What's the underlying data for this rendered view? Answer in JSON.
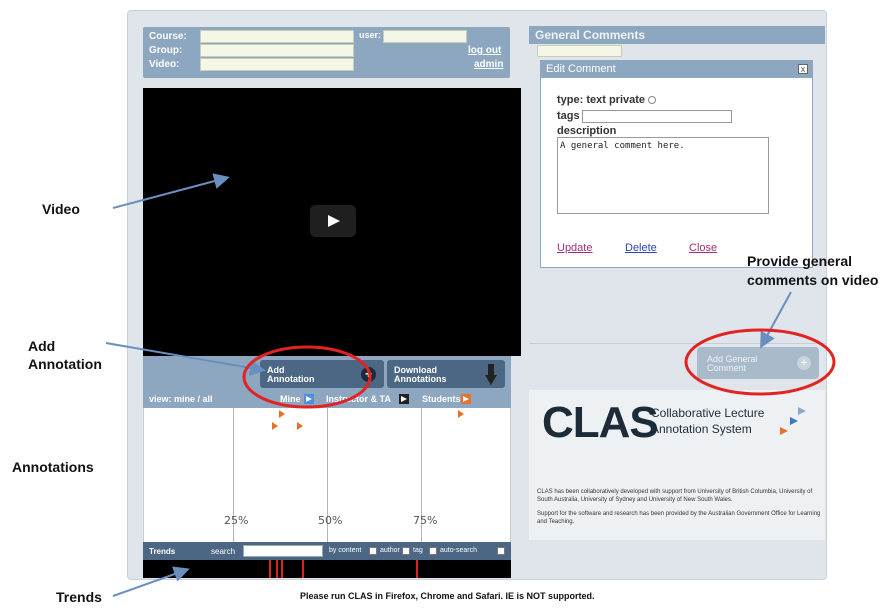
{
  "header": {
    "course_label": "Course:",
    "group_label": "Group:",
    "video_label": "Video:",
    "user_label": "user:",
    "course_value": "",
    "group_value": "",
    "video_value": "",
    "user_value": "",
    "logout_link": "log out",
    "admin_link": "admin"
  },
  "annotation_bar": {
    "add_line1": "Add",
    "add_line2": "Annotation",
    "add_plus": "+",
    "download_line1": "Download",
    "download_line2": "Annotations"
  },
  "filter_row": {
    "view_label": "view: mine / all",
    "mine": "Mine",
    "instructor": "Instructor & TA",
    "students": "Students"
  },
  "timeline": {
    "labels": [
      "25%",
      "50%",
      "75%"
    ]
  },
  "trends": {
    "title": "Trends",
    "search_label": "search",
    "search_value": "",
    "by_content": "by content",
    "author": "author",
    "tag": "tag",
    "auto_search": "auto-search"
  },
  "general_comments": {
    "title": "General Comments",
    "dialog_title": "Edit Comment",
    "close_x": "x",
    "type_label": "type: text private",
    "tags_label": "tags",
    "tags_value": "",
    "description_label": "description",
    "description_value": "A general comment here.",
    "update_link": "Update",
    "delete_link": "Delete",
    "close_link": "Close",
    "add_line1": "Add General",
    "add_line2": "Comment",
    "add_plus": "+"
  },
  "logo": {
    "name": "CLAS",
    "subtitle_line1": "Collaborative Lecture",
    "subtitle_line2": "Annotation System",
    "credits1": "CLAS has been collaboratively developed with support from University of British Columbia, University of South Australia, University of Sydney and University of New South Wales.",
    "credits2": "Support for the software and research has been provided by the Australian Government Office for Learning and Teaching."
  },
  "footer": "Please run CLAS in Firefox, Chrome and Safari. IE is NOT supported.",
  "callouts": {
    "video": "Video",
    "add_annotation_1": "Add",
    "add_annotation_2": "Annotation",
    "annotations": "Annotations",
    "trends": "Trends",
    "general_1": "Provide general",
    "general_2": "comments on video"
  },
  "colors": {
    "panel": "#8da7c1",
    "dark_button": "#4b6783",
    "highlight_circle": "#e32222",
    "arrow": "#6a8fbf",
    "marker": "#e8712a",
    "link_update": "#a0307a",
    "link_delete": "#2a44b0",
    "link_close": "#a0307a"
  }
}
